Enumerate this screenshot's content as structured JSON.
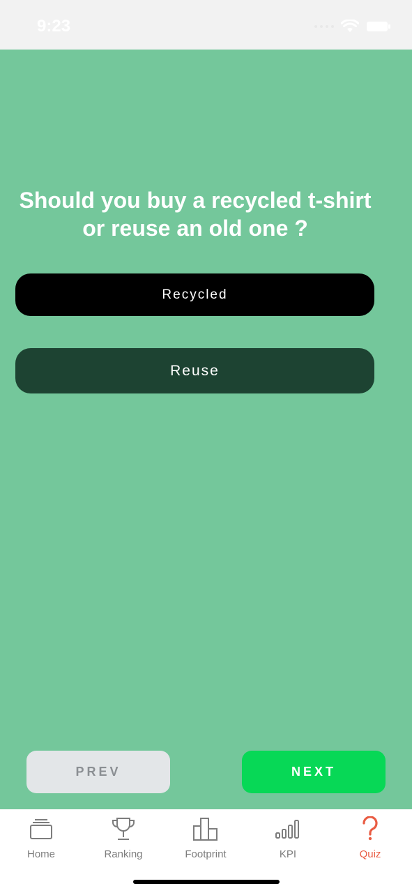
{
  "status_bar": {
    "time": "9:23"
  },
  "quiz": {
    "question": "Should you buy a recycled t-shirt or reuse an old one ?",
    "answers": [
      {
        "label": "Recycled"
      },
      {
        "label": "Reuse"
      }
    ],
    "prev_label": "PREV",
    "next_label": "NEXT"
  },
  "tab_bar": {
    "items": [
      {
        "label": "Home",
        "icon": "layers-icon"
      },
      {
        "label": "Ranking",
        "icon": "trophy-icon"
      },
      {
        "label": "Footprint",
        "icon": "bar-chart-icon"
      },
      {
        "label": "KPI",
        "icon": "signal-bars-icon"
      },
      {
        "label": "Quiz",
        "icon": "question-icon"
      }
    ],
    "active": "Quiz"
  },
  "colors": {
    "background": "#74c79b",
    "answer_primary": "#000000",
    "answer_secondary": "#1d4332",
    "next": "#07d856",
    "prev": "#e3e6e8",
    "active_tab": "#e95c43"
  }
}
